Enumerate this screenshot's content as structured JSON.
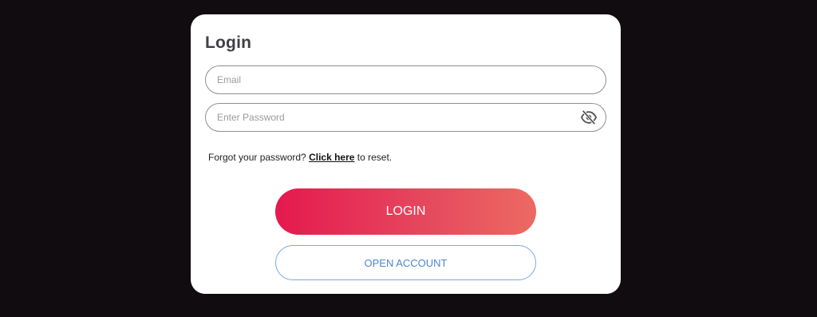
{
  "login_card": {
    "title": "Login",
    "email": {
      "placeholder": "Email",
      "value": ""
    },
    "password": {
      "placeholder": "Enter Password",
      "value": "",
      "toggle_icon": "eye-off-icon"
    },
    "forgot": {
      "prefix": "Forgot your password? ",
      "link": "Click here",
      "suffix": " to reset."
    },
    "login_label": "LOGIN",
    "open_account_label": "OPEN ACCOUNT"
  },
  "colors": {
    "page_background": "#100c10",
    "card_background": "#ffffff",
    "login_gradient_start": "#e5194f",
    "login_gradient_end": "#ec6a62",
    "open_account_border": "#79a8e0",
    "open_account_text": "#4b86cf"
  }
}
